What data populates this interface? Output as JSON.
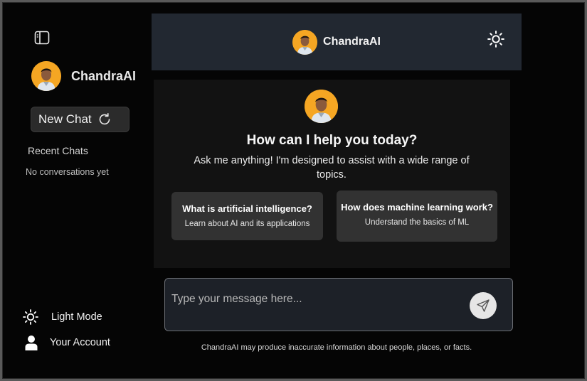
{
  "sidebar": {
    "brand_name": "ChandraAI",
    "new_chat_label": "New Chat",
    "recent_title": "Recent Chats",
    "empty_text": "No conversations yet",
    "light_mode_label": "Light Mode",
    "account_label": "Your Account"
  },
  "header": {
    "title": "ChandraAI"
  },
  "main": {
    "title": "How can I help you today?",
    "subtitle": "Ask me anything! I'm designed to assist with a wide range of topics.",
    "suggestions": [
      {
        "title": "What is artificial intelligence?",
        "description": "Learn about AI and its applications"
      },
      {
        "title": "How does machine learning work?",
        "description": "Understand the basics of ML"
      }
    ]
  },
  "composer": {
    "placeholder": "Type your message here..."
  },
  "footer": {
    "disclaimer": "ChandraAI may produce inaccurate information about people, places, or facts."
  },
  "icons": {
    "sidebar_toggle": "sidebar-toggle-icon",
    "refresh": "refresh-icon",
    "sun": "sun-icon",
    "user": "user-icon",
    "send": "send-icon"
  },
  "colors": {
    "background": "#050505",
    "header": "#222831",
    "panel": "#121212",
    "card": "#323232",
    "avatar": "#f5a623"
  }
}
